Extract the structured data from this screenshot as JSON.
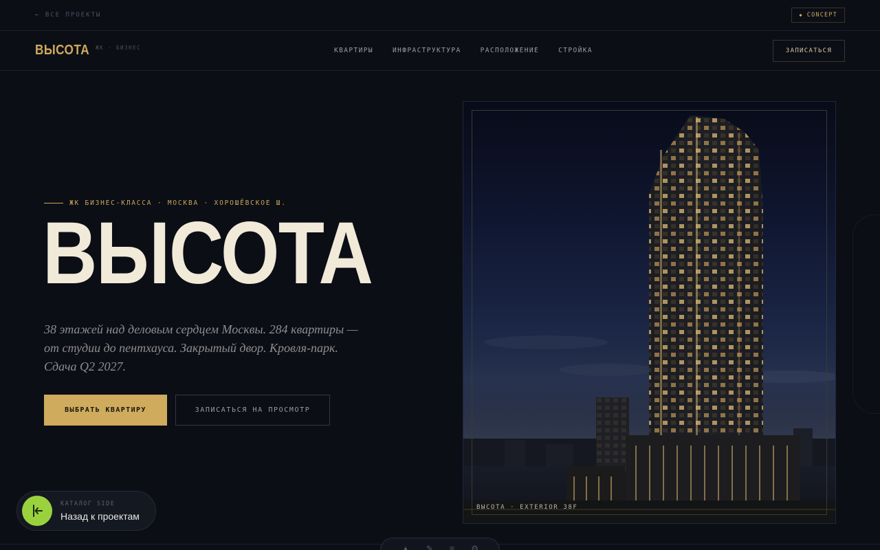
{
  "topbar": {
    "back_label": "← ВСЕ ПРОЕКТЫ",
    "badge_label": "CONCEPT"
  },
  "header": {
    "logo": "ВЫСОТА",
    "logo_sub": "ЖК · БИЗНЕС",
    "nav": [
      "КВАРТИРЫ",
      "ИНФРАСТРУКТУРА",
      "РАСПОЛОЖЕНИЕ",
      "СТРОЙКА"
    ],
    "cta": "ЗАПИСАТЬСЯ"
  },
  "hero": {
    "eyebrow": "ЖК БИЗНЕС-КЛАССА · МОСКВА · ХОРОШЁВСКОЕ Ш.",
    "title": "ВЫСОТА",
    "description": "38 этажей над деловым сердцем Москвы. 284 квартиры — от студии до пентхауса. Закрытый двор. Кровля-парк. Сдача Q2 2027.",
    "primary_button": "ВЫБРАТЬ КВАРТИРУ",
    "secondary_button": "ЗАПИСАТЬСЯ НА ПРОСМОТР",
    "image_caption": "ВЫСОТА · EXTERIOR 38F"
  },
  "back_pill": {
    "kicker": "КАТАЛОГ SIDE",
    "label": "Назад к проектам"
  },
  "colors": {
    "background": "#0c0e16",
    "accent_gold": "#ceab5d",
    "title_cream": "#f1ead9",
    "back_button_green": "#9ad23e"
  }
}
